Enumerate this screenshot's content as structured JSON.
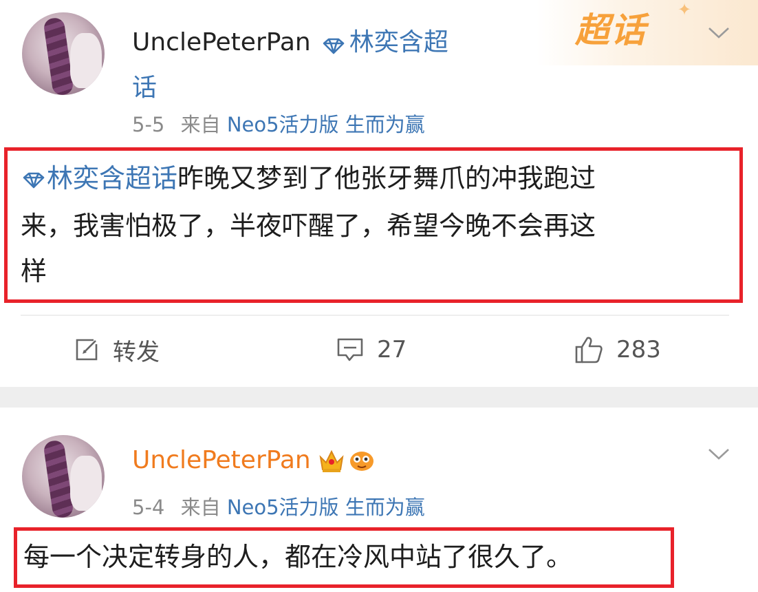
{
  "corner": {
    "label": "超话"
  },
  "post1": {
    "username": "UnclePeterPan",
    "topic_line1": "林奕含超",
    "topic_line2": "话",
    "date": "5-5",
    "from_label": "来自",
    "source": "Neo5活力版 生而为赢",
    "tag": "林奕含超话",
    "body_line1": "昨晚又梦到了他张牙舞爪的冲我跑过",
    "body_line2": "来，我害怕极了，半夜吓醒了，希望今晚不会再这",
    "body_line3": "样",
    "repost_label": "转发",
    "comment_count": "27",
    "like_count": "283"
  },
  "post2": {
    "username": "UnclePeterPan",
    "date": "5-4",
    "from_label": "来自",
    "source": "Neo5活力版 生而为赢",
    "body": "每一个决定转身的人，都在冷风中站了很久了。"
  },
  "icons": {
    "topic": "diamond-icon",
    "dropdown": "chevron-down-icon",
    "repost": "edit-repost-icon",
    "comment": "comment-icon",
    "like": "thumbs-up-icon",
    "crown": "crown-badge-icon",
    "fish": "fish-badge-icon"
  },
  "colors": {
    "link": "#3d76b4",
    "highlight_box": "#e8222a",
    "vip_name": "#f07b1e",
    "chaohua": "#f7a13b"
  }
}
